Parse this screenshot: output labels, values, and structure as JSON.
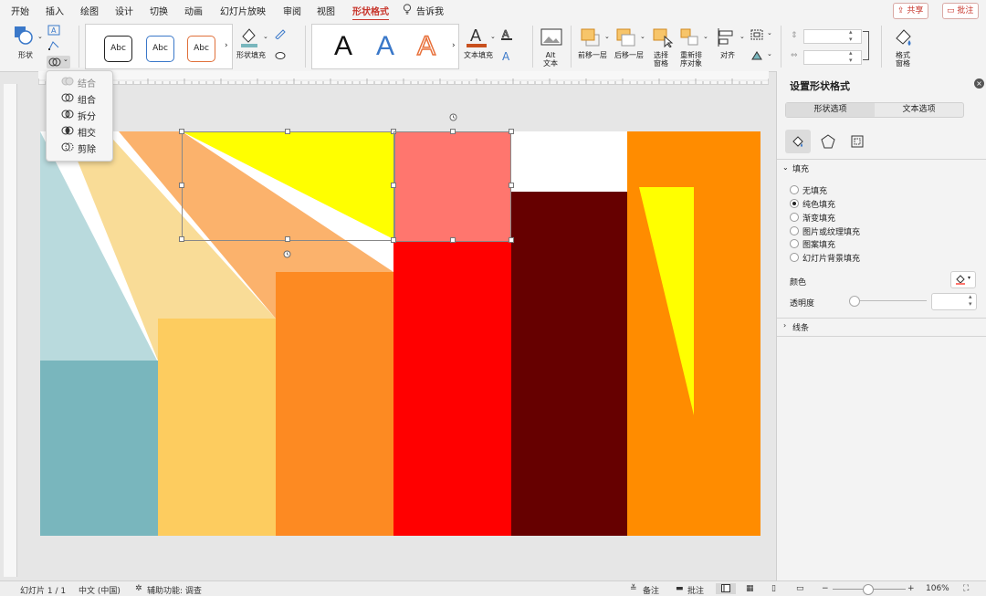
{
  "tabs": [
    {
      "label": "开始",
      "active": false
    },
    {
      "label": "插入",
      "active": false
    },
    {
      "label": "绘图",
      "active": false
    },
    {
      "label": "设计",
      "active": false
    },
    {
      "label": "切换",
      "active": false
    },
    {
      "label": "动画",
      "active": false
    },
    {
      "label": "幻灯片放映",
      "active": false
    },
    {
      "label": "审阅",
      "active": false
    },
    {
      "label": "视图",
      "active": false
    },
    {
      "label": "形状格式",
      "active": true
    },
    {
      "label": "告诉我",
      "active": false
    }
  ],
  "top_buttons": {
    "share": "共享",
    "comment": "批注"
  },
  "ribbon": {
    "shape_label": "形状",
    "shape_styles": [
      "Abc",
      "Abc",
      "Abc"
    ],
    "shape_fill_label": "形状填充",
    "wordart_letters": [
      "A",
      "A",
      "A"
    ],
    "text_fill_label": "文本填充",
    "alt_text_label": "Alt\n文本",
    "alt_text_line1": "Alt",
    "alt_text_line2": "文本",
    "bring_forward_label": "前移一层",
    "send_backward_label": "后移一层",
    "selection_pane_line1": "选择",
    "selection_pane_line2": "窗格",
    "reorder_line1": "重新排",
    "reorder_line2": "序对象",
    "align_label": "对齐",
    "format_pane_line1": "格式",
    "format_pane_line2": "窗格"
  },
  "merge_menu": {
    "items": [
      {
        "label": "结合",
        "enabled": false
      },
      {
        "label": "组合",
        "enabled": true
      },
      {
        "label": "拆分",
        "enabled": true
      },
      {
        "label": "相交",
        "enabled": true
      },
      {
        "label": "剪除",
        "enabled": true
      }
    ]
  },
  "panel": {
    "title": "设置形状格式",
    "tabs": [
      "形状选项",
      "文本选项"
    ],
    "fill_section": "填充",
    "fill_options": [
      {
        "label": "无填充",
        "selected": false
      },
      {
        "label": "纯色填充",
        "selected": true
      },
      {
        "label": "渐变填充",
        "selected": false
      },
      {
        "label": "图片或纹理填充",
        "selected": false
      },
      {
        "label": "图案填充",
        "selected": false
      },
      {
        "label": "幻灯片背景填充",
        "selected": false
      }
    ],
    "color_label": "颜色",
    "transparency_label": "透明度",
    "transparency_value": "",
    "line_section": "线条"
  },
  "status": {
    "slide": "幻灯片 1 / 1",
    "language": "中文 (中国)",
    "accessibility": "辅助功能: 调查",
    "notes": "备注",
    "comments": "批注",
    "zoom": "106%"
  },
  "colors": {
    "accent": "#c8372d",
    "slide_yellow": "#ffff00",
    "slide_salmon": "#ff766e",
    "slide_red": "#ff0000",
    "slide_dark_red": "#660000",
    "slide_orange": "#ff8c00",
    "slide_teal": "#79b6bd",
    "slide_light_teal": "#b9dadd"
  }
}
